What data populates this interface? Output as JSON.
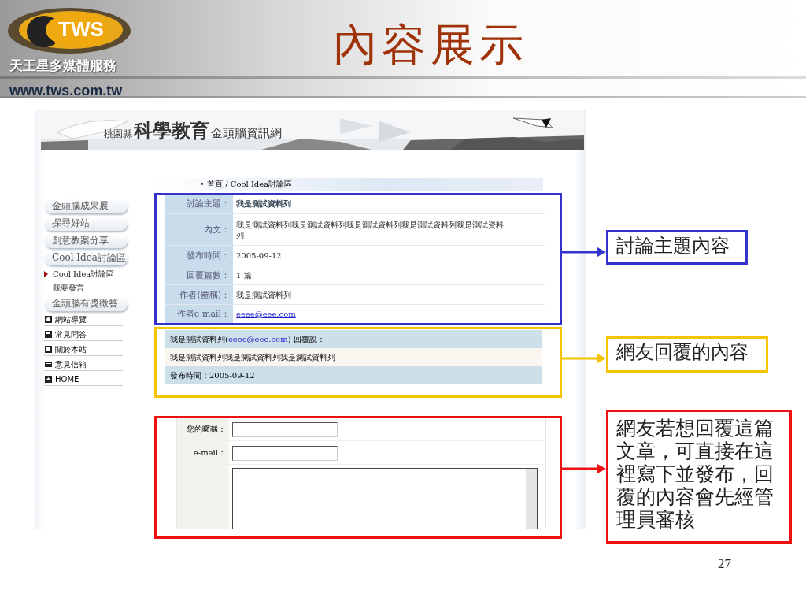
{
  "slide": {
    "logo": {
      "brand": "TWS",
      "company": "天王星多媒體服務",
      "url": "www.tws.com.tw"
    },
    "title": "內容展示",
    "page_number": "27"
  },
  "screenshot": {
    "banner": {
      "county": "桃園縣",
      "title": "科學教育",
      "subtitle": "金頭腦資訊網"
    },
    "breadcrumb_bullet": "•",
    "breadcrumb": "首頁 / Cool Idea討論區",
    "sidebar": [
      {
        "kind": "button",
        "label": "金頭腦成果展"
      },
      {
        "kind": "button",
        "label": "探尋好站"
      },
      {
        "kind": "button",
        "label": "創意教案分享"
      },
      {
        "kind": "button",
        "label": "Cool Idea討論區"
      },
      {
        "kind": "subitem",
        "label": "Cool Idea討論區",
        "selected": true
      },
      {
        "kind": "subitem",
        "label": "我要發言",
        "selected": false
      },
      {
        "kind": "button",
        "label": "金頭腦有獎徵答"
      },
      {
        "kind": "link",
        "label": "網站導覽"
      },
      {
        "kind": "link",
        "label": "常見問答"
      },
      {
        "kind": "link",
        "label": "關於本站"
      },
      {
        "kind": "link",
        "label": "意見信箱"
      },
      {
        "kind": "link",
        "label": "HOME"
      }
    ],
    "topic": [
      {
        "label": "討論主題：",
        "value": "我是測試資料列",
        "kind": "title"
      },
      {
        "label": "內文：",
        "value": "我是測試資料列我是測試資料列我是測試資料列我是測試資料列我是測試資料列",
        "kind": "text"
      },
      {
        "label": "發布時間：",
        "value": "2005-09-12",
        "kind": "text"
      },
      {
        "label": "回覆篇數：",
        "value": "1 篇",
        "kind": "text"
      },
      {
        "label": "作者(匿稱)：",
        "value": "我是測試資料列",
        "kind": "text"
      },
      {
        "label": "作者e-mail：",
        "value": "eeee@eee.com",
        "kind": "link"
      }
    ],
    "reply": {
      "author": "我是測試資料列(",
      "email": "eeee@eee.com",
      "says": ") 回覆說：",
      "body": "我是測試資料列我是測試資料列我是測試資料列",
      "date": "發布時間：2005-09-12"
    },
    "form": [
      {
        "kind": "input",
        "label": "您的暱稱："
      },
      {
        "kind": "input",
        "label": "e-mail："
      },
      {
        "kind": "textarea"
      }
    ]
  },
  "callouts": [
    {
      "text": "討論主題內容",
      "color": "#3333cc"
    },
    {
      "text": "網友回覆的內容",
      "color": "#f5c400"
    },
    {
      "text": "網友若想回覆這篇文章，可直接在這裡寫下並發布，回覆的內容會先經管理員審核",
      "color": "#ee1111"
    }
  ]
}
